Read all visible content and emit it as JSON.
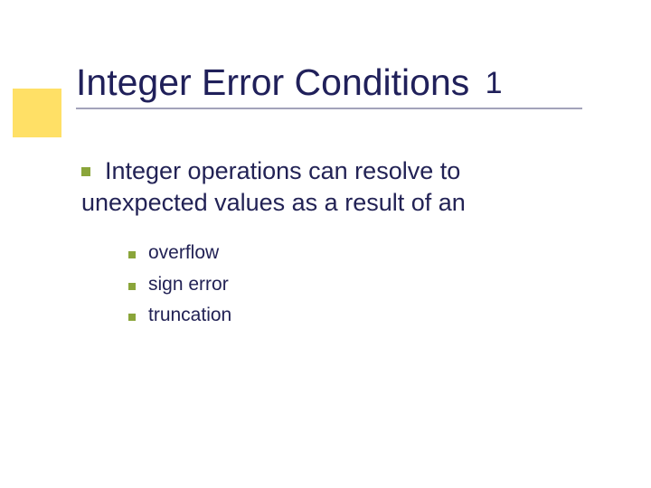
{
  "title": {
    "text": "Integer Error Conditions",
    "num": "1"
  },
  "body": {
    "text": "Integer operations can resolve to unexpected values as a result of an"
  },
  "subitems": [
    "overflow",
    "sign error",
    "truncation"
  ]
}
